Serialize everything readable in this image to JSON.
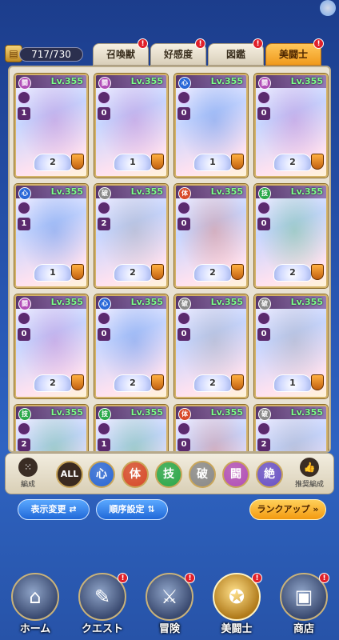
{
  "header": {
    "count": "717/730",
    "tabs": [
      {
        "label": "召喚獣",
        "notify": "!"
      },
      {
        "label": "好感度",
        "notify": "!"
      },
      {
        "label": "図鑑",
        "notify": "!"
      },
      {
        "label": "美闘士",
        "notify": "!"
      }
    ]
  },
  "cards": [
    {
      "attr": "闘",
      "lv": "Lv.355",
      "n1": "1",
      "n2": "2",
      "badge": "2",
      "color": "#b24fb8"
    },
    {
      "attr": "闘",
      "lv": "Lv.355",
      "n1": "0",
      "n2": "0",
      "badge": "1",
      "color": "#b24fb8"
    },
    {
      "attr": "心",
      "lv": "Lv.355",
      "n1": "0",
      "n2": "0",
      "badge": "1",
      "color": "#2a68d8"
    },
    {
      "attr": "闘",
      "lv": "Lv.355",
      "n1": "0",
      "n2": "0",
      "badge": "2",
      "color": "#b24fb8"
    },
    {
      "attr": "心",
      "lv": "Lv.355",
      "n1": "1",
      "n2": "1",
      "badge": "1",
      "color": "#2a68d8"
    },
    {
      "attr": "破",
      "lv": "Lv.355",
      "n1": "2",
      "n2": "2",
      "badge": "2",
      "color": "#8a8a8a"
    },
    {
      "attr": "体",
      "lv": "Lv.355",
      "n1": "0",
      "n2": "0",
      "badge": "2",
      "color": "#d84a2a"
    },
    {
      "attr": "技",
      "lv": "Lv.355",
      "n1": "0",
      "n2": "0",
      "badge": "2",
      "color": "#2aa84a"
    },
    {
      "attr": "闘",
      "lv": "Lv.355",
      "n1": "0",
      "n2": "0",
      "badge": "2",
      "color": "#b24fb8"
    },
    {
      "attr": "心",
      "lv": "Lv.355",
      "n1": "0",
      "n2": "0",
      "badge": "2",
      "color": "#2a68d8"
    },
    {
      "attr": "破",
      "lv": "Lv.355",
      "n1": "0",
      "n2": "0",
      "badge": "2",
      "color": "#8a8a8a"
    },
    {
      "attr": "破",
      "lv": "Lv.355",
      "n1": "0",
      "n2": "0",
      "badge": "1",
      "color": "#8a8a8a"
    },
    {
      "attr": "技",
      "lv": "Lv.355",
      "n1": "2",
      "n2": "2",
      "badge": "",
      "color": "#2aa84a"
    },
    {
      "attr": "技",
      "lv": "Lv.355",
      "n1": "1",
      "n2": "1",
      "badge": "",
      "color": "#2aa84a"
    },
    {
      "attr": "体",
      "lv": "Lv.355",
      "n1": "0",
      "n2": "0",
      "badge": "",
      "color": "#d84a2a"
    },
    {
      "attr": "破",
      "lv": "Lv.355",
      "n1": "2",
      "n2": "2",
      "badge": "",
      "color": "#8a8a8a"
    }
  ],
  "filter": {
    "compose_label": "編成",
    "all_label": "ALL",
    "attrs": [
      {
        "label": "心",
        "color": "#2a68d8"
      },
      {
        "label": "体",
        "color": "#d84a2a"
      },
      {
        "label": "技",
        "color": "#2aa84a"
      },
      {
        "label": "破",
        "color": "#8a8a8a"
      },
      {
        "label": "闘",
        "color": "#b24fb8"
      },
      {
        "label": "絶",
        "color": "#6a52c8"
      }
    ],
    "recommend_label": "推奨編成"
  },
  "actions": {
    "display_change": "表示変更",
    "order_setting": "順序設定",
    "rank_up": "ランクアップ"
  },
  "nav": [
    {
      "label": "ホーム",
      "icon": "home-icon",
      "glyph": "⌂",
      "notify": ""
    },
    {
      "label": "クエスト",
      "icon": "quest-icon",
      "glyph": "✎",
      "notify": "!"
    },
    {
      "label": "冒険",
      "icon": "adventure-icon",
      "glyph": "⚔",
      "notify": "!"
    },
    {
      "label": "美闘士",
      "icon": "fighter-icon",
      "glyph": "✪",
      "notify": "!"
    },
    {
      "label": "商店",
      "icon": "shop-icon",
      "glyph": "▣",
      "notify": "!"
    }
  ]
}
